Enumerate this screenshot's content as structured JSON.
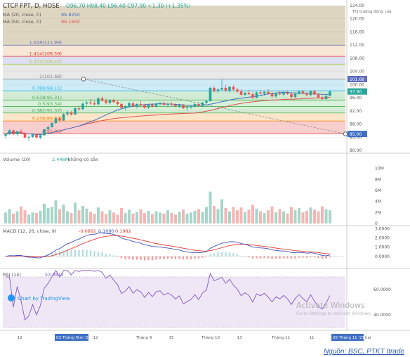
{
  "header": {
    "symbol": "CTCP FPT, D, HOSE",
    "ohlc": "O96.70 H98.40 L96.40 C97.90 +1.30 (+1.35%)",
    "ma20": "MA (20, close, 0)",
    "ma20_value": "96.8250",
    "ma50": "MA (50, close, 0)",
    "ma50_value": "96.1600",
    "market_status": "Thị trường đóng cửa"
  },
  "price_axis": {
    "labels": [
      "124.00",
      "120.00",
      "116.00",
      "112.00",
      "108.00",
      "104.00",
      "100.00",
      "96.00",
      "92.00",
      "88.00",
      "84.00",
      "80.00"
    ],
    "tags": [
      {
        "text": "101.68",
        "color": "#5c6bc0"
      },
      {
        "text": "97.90",
        "color": "#26a69a"
      },
      {
        "text": "85.00",
        "color": "#3f6fc4"
      }
    ]
  },
  "fib_labels": [
    {
      "text": "1.618(111.99)",
      "color": "#5c6bc0"
    },
    {
      "text": "1.414(108.59)",
      "color": "#e53935"
    },
    {
      "text": "1.272(106.22)",
      "color": "#9ccc33"
    },
    {
      "text": "1(101.68)",
      "color": "#808080"
    },
    {
      "text": "0.786(98.11)",
      "color": "#29b6f6"
    },
    {
      "text": "0.618(95.31)",
      "color": "#4caf50"
    },
    {
      "text": "0.5(93.34)",
      "color": "#4caf50"
    },
    {
      "text": "0.382(91.37)",
      "color": "#4caf50"
    },
    {
      "text": "0.236(88.94)",
      "color": "#f57c00"
    },
    {
      "text": "0(85.00)",
      "color": "#ef5350"
    }
  ],
  "volume": {
    "label": "Volume (20)",
    "value": "2.446M",
    "na": "không có sẵn",
    "axis_labels": [
      "10M",
      "8M",
      "6M",
      "4M",
      "2M",
      "0"
    ]
  },
  "macd": {
    "label": "MACD (12, 26, close, 9)",
    "v1": "-0.0892",
    "v2": "0.1090",
    "v3": "0.1982",
    "axis_labels": [
      "3.0000",
      "2.0000",
      "1.0000",
      "0.0000"
    ]
  },
  "rsi": {
    "label": "RSI (14)",
    "value": "53.0812",
    "axis_labels": [
      "60.0000",
      "40.0000"
    ]
  },
  "time_axis": {
    "labels": [
      "13",
      "12",
      "Tháng 9",
      "15",
      "Tháng 10",
      "13",
      "Tháng 11",
      "11",
      "13"
    ],
    "highlight_left": "03 Tháng Tám '21",
    "highlight_right": "26 Tháng 11 '21",
    "day_suffix": "hai"
  },
  "watermark": {
    "brand": "Chart by TradingView",
    "activate_title": "Activate Windows",
    "activate_sub": "Go to Settings to activate Windows."
  },
  "caption": "Nguồn: BSC, PTKT Itrade",
  "colors": {
    "up": "#26a69a",
    "down": "#ef5350",
    "ma20": "#3f6fc4",
    "ma50": "#e05050",
    "macd": "#3f51b5",
    "signal": "#e53935",
    "rsi": "#7e57c2"
  },
  "chart_data": {
    "type": "candlestick",
    "title": "CTCP FPT, D, HOSE",
    "ylim": [
      80,
      124
    ],
    "fibonacci_levels": [
      {
        "ratio": 0,
        "price": 85.0
      },
      {
        "ratio": 0.236,
        "price": 88.94
      },
      {
        "ratio": 0.382,
        "price": 91.37
      },
      {
        "ratio": 0.5,
        "price": 93.34
      },
      {
        "ratio": 0.618,
        "price": 95.31
      },
      {
        "ratio": 0.786,
        "price": 98.11
      },
      {
        "ratio": 1,
        "price": 101.68
      },
      {
        "ratio": 1.272,
        "price": 106.22
      },
      {
        "ratio": 1.414,
        "price": 108.59
      },
      {
        "ratio": 1.618,
        "price": 111.99
      }
    ],
    "candles": [
      [
        84.5,
        85.2,
        83.6,
        85.0
      ],
      [
        85.0,
        86.4,
        84.7,
        86.1
      ],
      [
        86.1,
        86.3,
        84.6,
        84.9
      ],
      [
        84.9,
        86.0,
        84.4,
        85.8
      ],
      [
        85.8,
        86.4,
        85.0,
        85.2
      ],
      [
        85.2,
        85.6,
        83.6,
        83.9
      ],
      [
        83.9,
        84.4,
        82.9,
        84.1
      ],
      [
        84.1,
        85.2,
        83.8,
        84.8
      ],
      [
        84.8,
        85.0,
        83.6,
        83.9
      ],
      [
        83.9,
        84.8,
        83.5,
        84.6
      ],
      [
        84.6,
        86.6,
        84.4,
        86.4
      ],
      [
        86.4,
        87.4,
        86.0,
        87.1
      ],
      [
        87.1,
        88.6,
        86.9,
        88.3
      ],
      [
        88.3,
        90.0,
        88.1,
        89.7
      ],
      [
        89.7,
        90.2,
        88.7,
        89.1
      ],
      [
        89.1,
        91.4,
        88.9,
        91.0
      ],
      [
        91.0,
        92.1,
        90.4,
        91.6
      ],
      [
        91.6,
        92.0,
        90.6,
        90.9
      ],
      [
        90.9,
        93.2,
        90.7,
        92.8
      ],
      [
        92.8,
        93.6,
        92.1,
        92.5
      ],
      [
        92.5,
        94.6,
        92.3,
        94.2
      ],
      [
        94.2,
        95.0,
        93.6,
        94.6
      ],
      [
        94.6,
        95.6,
        94.0,
        94.3
      ],
      [
        94.3,
        95.0,
        93.6,
        94.0
      ],
      [
        94.0,
        96.2,
        93.8,
        95.8
      ],
      [
        95.8,
        96.4,
        94.8,
        95.1
      ],
      [
        95.1,
        95.8,
        94.0,
        94.4
      ],
      [
        94.4,
        95.6,
        94.0,
        95.3
      ],
      [
        95.3,
        95.7,
        94.3,
        94.7
      ],
      [
        94.7,
        95.2,
        93.6,
        94.1
      ],
      [
        94.1,
        94.6,
        92.6,
        92.9
      ],
      [
        92.9,
        93.8,
        92.1,
        93.4
      ],
      [
        93.4,
        94.8,
        93.0,
        94.3
      ],
      [
        94.3,
        94.8,
        93.1,
        93.4
      ],
      [
        93.4,
        94.4,
        92.8,
        94.1
      ],
      [
        94.1,
        94.9,
        93.4,
        93.8
      ],
      [
        93.8,
        94.2,
        92.6,
        93.0
      ],
      [
        93.0,
        94.2,
        92.6,
        93.9
      ],
      [
        93.9,
        94.4,
        93.0,
        93.3
      ],
      [
        93.3,
        94.5,
        93.0,
        94.2
      ],
      [
        94.2,
        94.8,
        93.6,
        94.4
      ],
      [
        94.4,
        94.9,
        93.6,
        93.8
      ],
      [
        93.8,
        94.6,
        93.2,
        94.2
      ],
      [
        94.2,
        94.7,
        93.5,
        93.9
      ],
      [
        93.9,
        94.4,
        93.1,
        93.4
      ],
      [
        93.4,
        94.2,
        92.8,
        93.9
      ],
      [
        93.9,
        94.1,
        92.6,
        92.8
      ],
      [
        92.8,
        93.4,
        92.0,
        93.1
      ],
      [
        93.1,
        93.8,
        92.6,
        93.4
      ],
      [
        93.4,
        94.4,
        93.0,
        94.1
      ],
      [
        94.1,
        94.6,
        93.2,
        93.5
      ],
      [
        93.5,
        94.8,
        93.2,
        94.5
      ],
      [
        94.5,
        95.4,
        94.0,
        95.0
      ],
      [
        95.0,
        99.4,
        94.8,
        99.0
      ],
      [
        99.0,
        99.6,
        97.6,
        98.0
      ],
      [
        98.0,
        98.9,
        97.3,
        98.5
      ],
      [
        98.5,
        101.6,
        98.1,
        99.0
      ],
      [
        99.0,
        99.8,
        97.8,
        98.2
      ],
      [
        98.2,
        99.6,
        97.6,
        99.3
      ],
      [
        99.3,
        99.8,
        98.1,
        98.5
      ],
      [
        98.5,
        99.0,
        97.4,
        97.9
      ],
      [
        97.9,
        98.6,
        96.6,
        96.9
      ],
      [
        96.9,
        97.8,
        96.4,
        97.5
      ],
      [
        97.5,
        98.3,
        96.8,
        97.1
      ],
      [
        97.1,
        97.6,
        95.6,
        96.0
      ],
      [
        96.0,
        97.9,
        95.8,
        97.6
      ],
      [
        97.6,
        98.4,
        97.0,
        97.3
      ],
      [
        97.3,
        98.1,
        96.6,
        97.8
      ],
      [
        97.8,
        98.6,
        97.0,
        97.2
      ],
      [
        97.2,
        97.8,
        96.0,
        96.4
      ],
      [
        96.4,
        97.6,
        96.0,
        97.3
      ],
      [
        97.3,
        98.1,
        96.8,
        97.0
      ],
      [
        97.0,
        97.8,
        96.4,
        97.6
      ],
      [
        97.6,
        98.2,
        96.9,
        97.1
      ],
      [
        97.1,
        97.5,
        95.8,
        96.2
      ],
      [
        96.2,
        97.4,
        95.9,
        97.2
      ],
      [
        97.2,
        98.2,
        96.9,
        97.9
      ],
      [
        97.9,
        98.4,
        97.0,
        97.3
      ],
      [
        97.3,
        97.8,
        96.4,
        96.8
      ],
      [
        96.8,
        98.2,
        96.6,
        98.0
      ],
      [
        98.0,
        98.4,
        96.8,
        97.0
      ],
      [
        97.0,
        97.4,
        95.8,
        96.1
      ],
      [
        96.1,
        96.8,
        95.2,
        95.6
      ],
      [
        95.6,
        96.8,
        95.4,
        96.6
      ],
      [
        96.6,
        98.4,
        96.4,
        97.9
      ]
    ],
    "volume_millions": [
      2.0,
      2.6,
      1.8,
      2.2,
      3.1,
      2.4,
      1.6,
      2.0,
      1.9,
      2.3,
      3.6,
      2.8,
      3.0,
      4.2,
      2.6,
      3.4,
      2.2,
      1.9,
      3.8,
      2.4,
      3.2,
      2.7,
      2.1,
      1.8,
      2.9,
      2.2,
      1.7,
      2.4,
      2.0,
      1.6,
      2.8,
      1.9,
      2.5,
      1.8,
      2.1,
      2.6,
      1.9,
      2.3,
      1.7,
      2.2,
      2.0,
      1.8,
      2.4,
      1.9,
      1.6,
      2.1,
      2.5,
      1.8,
      2.0,
      2.3,
      2.6,
      2.1,
      3.0,
      5.8,
      3.2,
      2.6,
      4.4,
      2.8,
      2.2,
      3.0,
      2.4,
      2.9,
      2.1,
      2.5,
      3.4,
      2.7,
      2.2,
      1.9,
      2.4,
      3.1,
      2.0,
      2.6,
      2.2,
      1.8,
      3.0,
      2.4,
      2.8,
      2.0,
      2.3,
      2.9,
      2.5,
      2.2,
      3.1,
      2.6,
      2.4
    ],
    "volume_ylim": [
      0,
      12
    ],
    "macd_ylim": [
      -1.0,
      3.1
    ],
    "rsi_ylim": [
      30,
      75
    ]
  }
}
